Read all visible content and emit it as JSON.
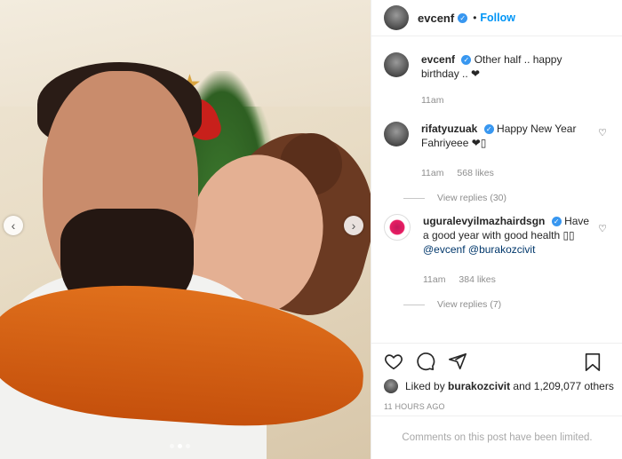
{
  "post": {
    "username": "evcenf",
    "follow_label": "Follow",
    "separator": "•",
    "caption_text": "Other half .. happy birthday .. ❤",
    "caption_time": "11am"
  },
  "comments": [
    {
      "user": "rifatyuzuak",
      "text": "Happy New Year Fahriyeee ❤▯",
      "time": "11am",
      "likes": "568 likes",
      "replies": "View replies (30)"
    },
    {
      "user": "uguralevyilmazhairdsgn",
      "text": "Have a good year with good health ▯▯",
      "mention1": "@evcenf",
      "mention2": "@burakozcivit",
      "time": "11am",
      "likes": "384 likes",
      "replies": "View replies (7)"
    }
  ],
  "footer": {
    "liked_by_prefix": "Liked by",
    "liked_by_user": "burakozcivit",
    "liked_by_suffix": "and 1,209,077 others",
    "timestamp": "11 HOURS AGO",
    "comments_limited": "Comments on this post have been limited."
  },
  "icons": [
    "heart-icon",
    "comment-icon",
    "share-icon",
    "bookmark-icon",
    "chevron-left-icon",
    "chevron-right-icon"
  ],
  "colors": {
    "accent": "#0095f6",
    "verified": "#3897f0",
    "muted": "#8e8e8e"
  }
}
